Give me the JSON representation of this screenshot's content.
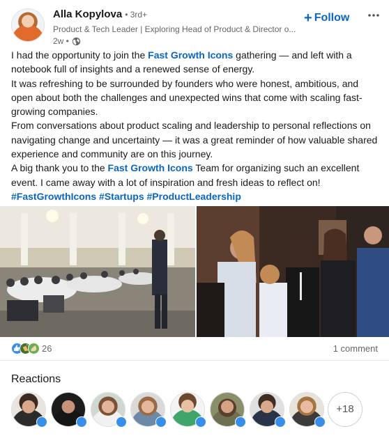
{
  "author": {
    "name": "Alla Kopylova",
    "degree": "• 3rd+",
    "headline": "Product & Tech Leader | Exploring Head of Product & Director o...",
    "time": "2w •",
    "visibility_icon": "globe-icon"
  },
  "actions": {
    "follow_label": "Follow",
    "follow_icon": "plus-icon",
    "more_icon": "more-icon"
  },
  "post": {
    "p1_before": "I had the opportunity to join the ",
    "p1_link": "Fast Growth Icons",
    "p1_after": " gathering — and left with a notebook full of insights and a renewed sense of energy.",
    "p2": "It was refreshing to be surrounded by founders who were honest, ambitious, and open about both the challenges and unexpected wins that come with scaling fast-growing companies.",
    "p3": "From conversations about product scaling and leadership to personal reflections on navigating change and uncertainty — it was a great reminder of how valuable shared experience and community are on this journey.",
    "p4_before": "A big thank you to the ",
    "p4_link": "Fast Growth Icons",
    "p4_after": " Team for organizing such an excellent event. I came away with a lot of inspiration and fresh ideas to reflect on!",
    "hashtags": [
      "#FastGrowthIcons",
      "#Startups",
      "#ProductLeadership"
    ]
  },
  "social": {
    "reaction_count": "26",
    "comments": "1 comment",
    "reaction_icons": [
      "like-icon",
      "celebrate-icon",
      "support-icon"
    ]
  },
  "reactions": {
    "title": "Reactions",
    "more_count": "+18"
  },
  "colors": {
    "link": "#0a66c2",
    "like": "#378fe9",
    "celebrate": "#44712e",
    "support": "#6dae4f"
  }
}
